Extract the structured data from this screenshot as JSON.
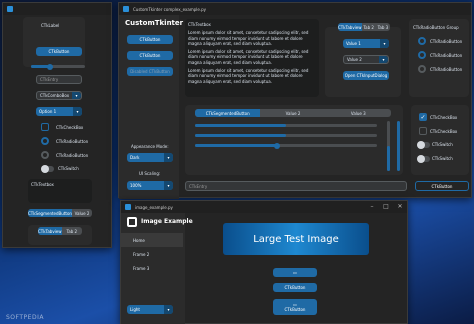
{
  "main": {
    "title": "CustomTkinter complex_example.py",
    "app_label": "CustomTkinter",
    "sidebar_label": "CTkLabel",
    "sidebar_buttons": [
      "CTkButton",
      "CTkButton",
      "Disabled CTkButton"
    ],
    "textbox_title": "CTkTextbox",
    "lorem": "Lorem ipsum dolor sit amet, consetetur sadipscing elitr, sed diam nonumy eirmod tempor invidunt ut labore et dolore magna aliquyam erat, sed diam voluptua.",
    "tabview_tabs": [
      "CTkTabview",
      "Tab 2",
      "Tab 3"
    ],
    "tab_option": "Value 1",
    "tab_combo": "Value 2",
    "open_dialog": "Open CTkInputDialog",
    "radio_group_title": "CTkRadioButton Group",
    "radio_label": "CTkRadioButton",
    "segmented": [
      "CTkSegmentedButton",
      "Value 2",
      "Value 3"
    ],
    "appearance_label": "Appearance Mode:",
    "appearance_value": "Dark",
    "scaling_label": "UI Scaling:",
    "scaling_value": "100%",
    "entry_placeholder": "CTkEntry",
    "entry_button": "CTkButton",
    "checkbox_label": "CTkCheckBox",
    "switch_label": "CTkSwitch",
    "progress_1": 0.5,
    "progress_2": 0.5,
    "slider_1": 0.45,
    "vslider": 0.5,
    "vprogress": 0.55
  },
  "left": {
    "label": "CTkLabel",
    "button": "CTkButton",
    "entry": "CTkEntry",
    "combobox": "CTkComboBox",
    "option": "Option 1",
    "checkbox": "CTkCheckBox",
    "radio1": "CTkRadioButton",
    "radio2": "CTkRadioButton",
    "switch": "CTkSwitch",
    "textbox": "CTkTextbox",
    "segmented": [
      "CTkSegmentedButton",
      "Value 2"
    ],
    "tabview": [
      "CTkTabview",
      "Tab 2"
    ],
    "slider": 0.35
  },
  "image_win": {
    "title": "image_example.py",
    "header": "Image Example",
    "nav": [
      "Home",
      "Frame 2",
      "Frame 3"
    ],
    "large_image": "Large Test Image",
    "button_2": "CTkButton",
    "button_3": "CTkButton",
    "appearance": "Light"
  },
  "watermark": "SOFTPEDIA",
  "colors": {
    "accent": "#1f6aa5",
    "bg": "#242424",
    "frame": "#2b2b2b"
  },
  "icons": [
    "minimize-icon",
    "maximize-icon",
    "close-icon",
    "image-icon",
    "check-icon"
  ]
}
